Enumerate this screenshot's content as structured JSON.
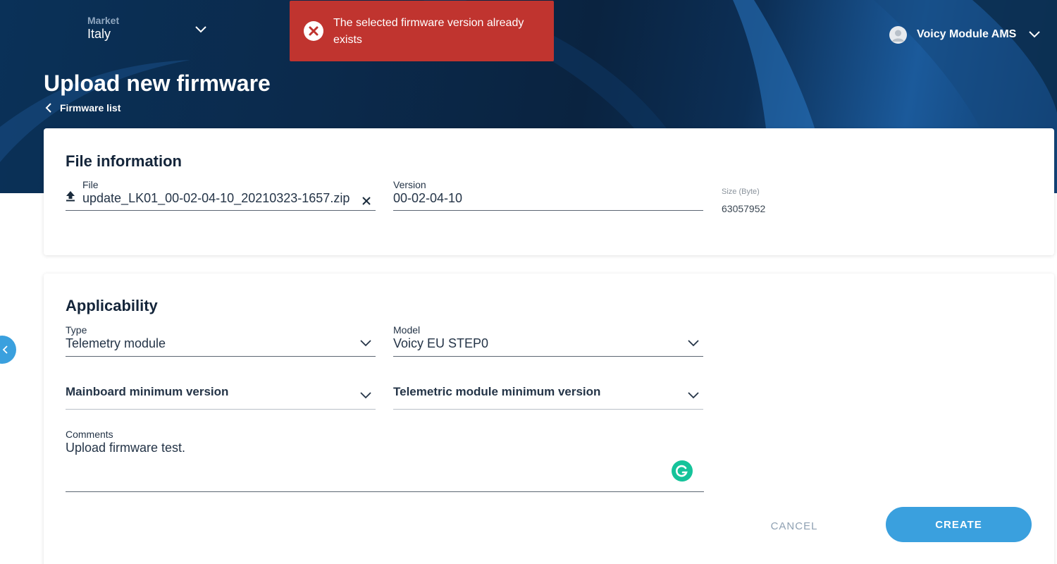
{
  "header": {
    "market_label": "Market",
    "market_value": "Italy",
    "user_name": "Voicy Module AMS"
  },
  "toast": {
    "message": "The selected firmware version already exists",
    "color": "#c0342f"
  },
  "page": {
    "title": "Upload new firmware",
    "back_link": "Firmware list"
  },
  "file_info": {
    "title": "File information",
    "file_label": "File",
    "file_value": "update_LK01_00-02-04-10_20210323-1657.zip",
    "version_label": "Version",
    "version_value": "00-02-04-10",
    "size_label": "Size (Byte)",
    "size_value": "63057952"
  },
  "applicability": {
    "title": "Applicability",
    "type_label": "Type",
    "type_value": "Telemetry module",
    "model_label": "Model",
    "model_value": "Voicy EU STEP0",
    "mainboard_label": "Mainboard minimum version",
    "telemetric_label": "Telemetric module minimum version",
    "comments_label": "Comments",
    "comments_value": "Upload firmware test."
  },
  "actions": {
    "cancel": "CANCEL",
    "create": "CREATE",
    "accent": "#3aa0de"
  },
  "icons": [
    "chevron-down-icon",
    "error-circle-icon",
    "user-avatar-icon",
    "chevron-left-icon",
    "upload-icon",
    "close-icon",
    "grammarly-icon"
  ]
}
